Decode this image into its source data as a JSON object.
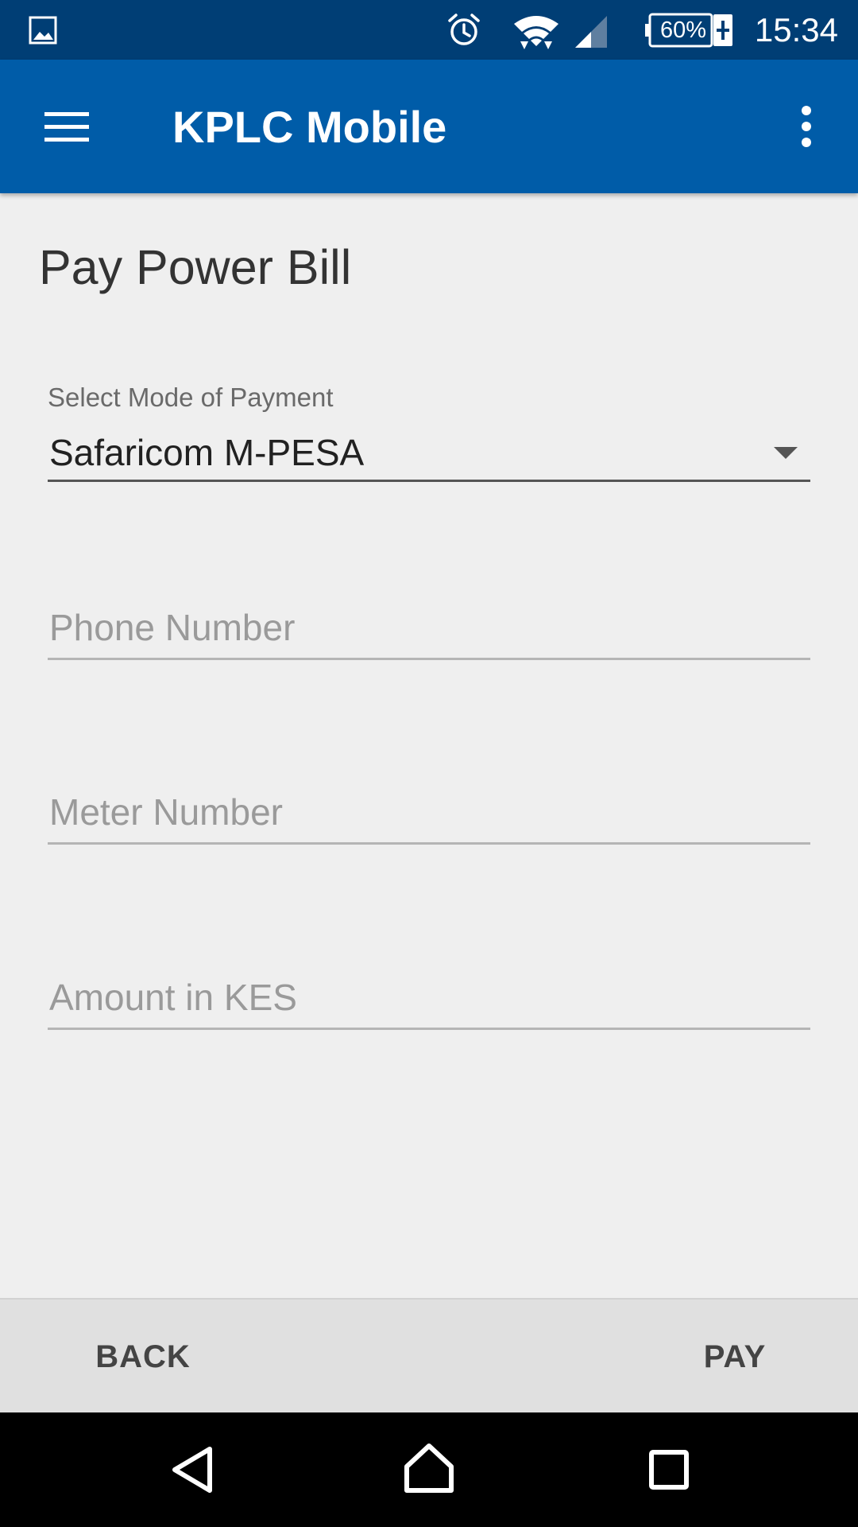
{
  "status_bar": {
    "time": "15:34",
    "battery_percent": "60%",
    "icons": [
      "gallery-icon",
      "alarm-icon",
      "wifi-icon",
      "cell-signal-icon",
      "battery-charging-icon"
    ]
  },
  "app_bar": {
    "title": "KPLC Mobile",
    "left_icon": "hamburger-menu-icon",
    "right_icon": "overflow-menu-icon"
  },
  "page": {
    "title": "Pay Power Bill"
  },
  "form": {
    "payment_mode": {
      "label": "Select Mode of Payment",
      "selected": "Safaricom M-PESA"
    },
    "phone_number": {
      "placeholder": "Phone Number",
      "value": ""
    },
    "meter_number": {
      "placeholder": "Meter Number",
      "value": ""
    },
    "amount": {
      "placeholder": "Amount in KES",
      "value": ""
    }
  },
  "actions": {
    "back_label": "BACK",
    "pay_label": "PAY"
  },
  "nav_bar": {
    "icons": [
      "back-triangle-icon",
      "home-icon",
      "recents-square-icon"
    ]
  },
  "colors": {
    "status_bar": "#003e75",
    "app_bar": "#005ca8",
    "background": "#efefef",
    "action_bar": "#e0e0e0"
  }
}
